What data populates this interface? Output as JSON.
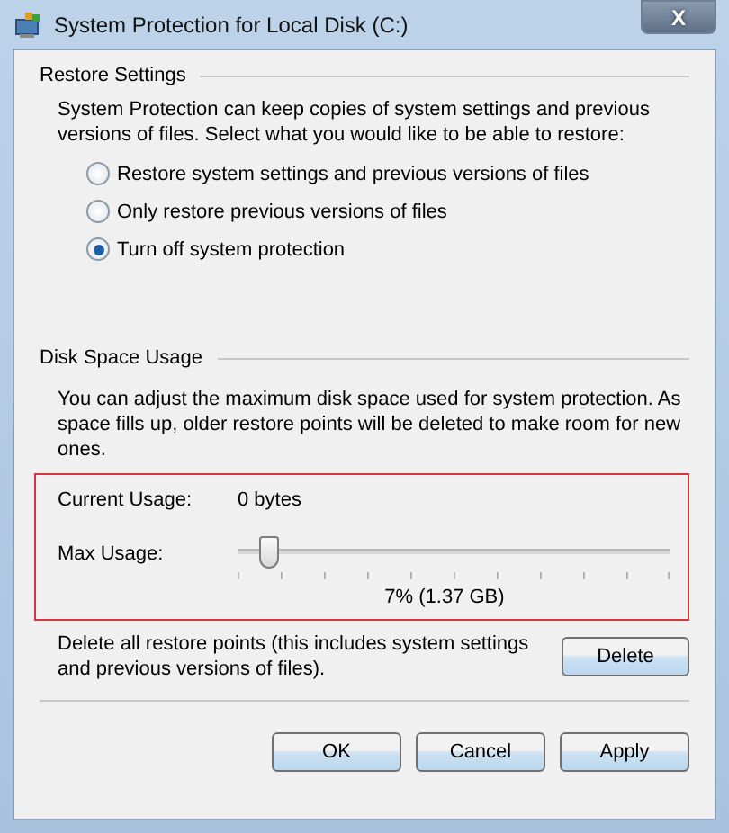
{
  "window": {
    "title": "System Protection for Local Disk (C:)",
    "close": "X"
  },
  "restore_settings": {
    "heading": "Restore Settings",
    "description": "System Protection can keep copies of system settings and previous versions of files. Select what you would like to be able to restore:",
    "options": [
      {
        "label": "Restore system settings and previous versions of files",
        "selected": false
      },
      {
        "label": "Only restore previous versions of files",
        "selected": false
      },
      {
        "label": "Turn off system protection",
        "selected": true
      }
    ]
  },
  "disk_space_usage": {
    "heading": "Disk Space Usage",
    "description": "You can adjust the maximum disk space used for system protection. As space fills up, older restore points will be deleted to make room for new ones.",
    "current_usage": {
      "label": "Current Usage:",
      "value": "0 bytes"
    },
    "max_usage": {
      "label": "Max Usage:",
      "level": 0.07,
      "reading": "7% (1.37 GB)"
    },
    "delete_text": "Delete all restore points (this includes system settings and previous versions of files).",
    "delete_button": "Delete"
  },
  "buttons": [
    "OK",
    "Cancel",
    "Apply"
  ]
}
